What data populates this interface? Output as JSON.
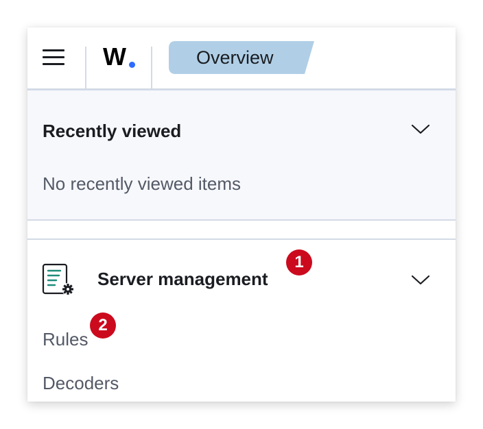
{
  "header": {
    "menu_icon": "hamburger-menu-icon",
    "logo_text": "W",
    "logo_accent_color": "#2e6bff",
    "breadcrumb_label": "Overview",
    "breadcrumb_color": "#b0cfe6"
  },
  "recently_viewed": {
    "title": "Recently viewed",
    "empty_message": "No recently viewed items",
    "toggle_icon": "chevron-down-icon"
  },
  "server_management": {
    "title": "Server management",
    "icon": "server-management-icon",
    "toggle_icon": "chevron-down-icon",
    "links": [
      {
        "label": "Rules"
      },
      {
        "label": "Decoders"
      }
    ]
  },
  "annotations": {
    "badge_1": "1",
    "badge_2": "2",
    "badge_color": "#cc0a1e"
  }
}
